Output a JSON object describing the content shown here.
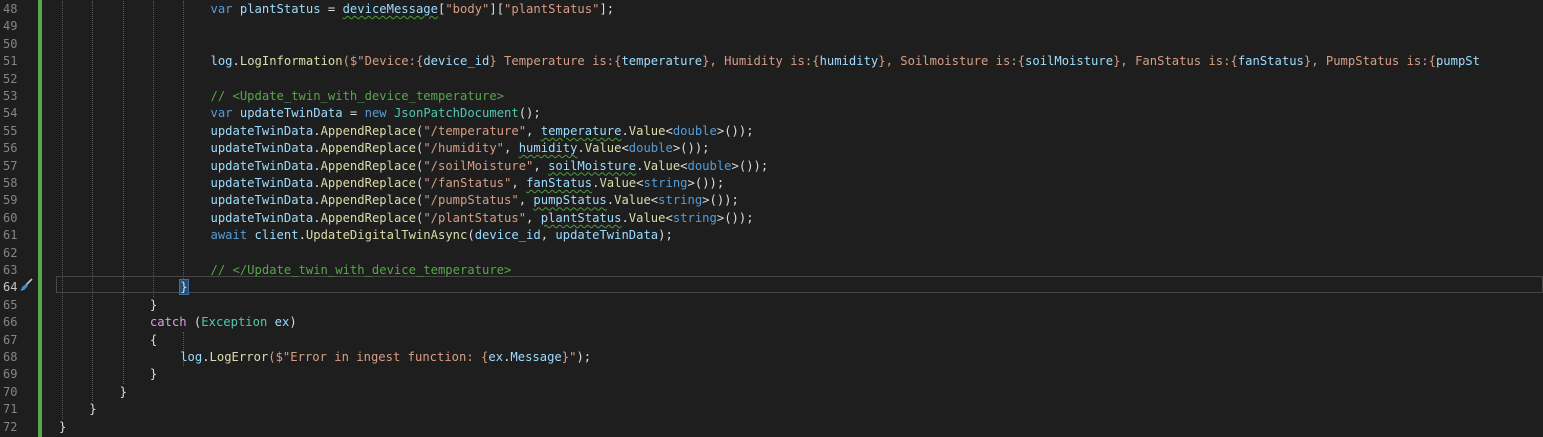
{
  "editor": {
    "line_numbers": [
      "48",
      "49",
      "50",
      "51",
      "52",
      "53",
      "54",
      "55",
      "56",
      "57",
      "58",
      "59",
      "60",
      "61",
      "62",
      "63",
      "64",
      "65",
      "66",
      "67",
      "68",
      "69",
      "70",
      "71",
      "72"
    ],
    "current_line": "64",
    "lines": [
      {
        "indent": 5,
        "tokens": [
          {
            "t": "var ",
            "c": "kw"
          },
          {
            "t": "plantStatus",
            "c": "var"
          },
          {
            "t": " = ",
            "c": "plain"
          },
          {
            "t": "deviceMessage",
            "c": "var",
            "sq": true
          },
          {
            "t": "[",
            "c": "plain"
          },
          {
            "t": "\"body\"",
            "c": "str"
          },
          {
            "t": "][",
            "c": "plain"
          },
          {
            "t": "\"plantStatus\"",
            "c": "str"
          },
          {
            "t": "];",
            "c": "plain"
          }
        ]
      },
      {
        "indent": 0,
        "tokens": []
      },
      {
        "indent": 0,
        "tokens": []
      },
      {
        "indent": 5,
        "tokens": [
          {
            "t": "log",
            "c": "var"
          },
          {
            "t": ".",
            "c": "plain"
          },
          {
            "t": "LogInformation",
            "c": "method"
          },
          {
            "t": "($\"Device:{",
            "c": "str"
          },
          {
            "t": "device_id",
            "c": "interp"
          },
          {
            "t": "} Temperature is:{",
            "c": "str"
          },
          {
            "t": "temperature",
            "c": "interp"
          },
          {
            "t": "}, Humidity is:{",
            "c": "str"
          },
          {
            "t": "humidity",
            "c": "interp"
          },
          {
            "t": "}, Soilmoisture is:{",
            "c": "str"
          },
          {
            "t": "soilMoisture",
            "c": "interp"
          },
          {
            "t": "}, FanStatus is:{",
            "c": "str"
          },
          {
            "t": "fanStatus",
            "c": "interp"
          },
          {
            "t": "}, PumpStatus is:{",
            "c": "str"
          },
          {
            "t": "pumpSt",
            "c": "interp"
          }
        ]
      },
      {
        "indent": 0,
        "tokens": []
      },
      {
        "indent": 5,
        "tokens": [
          {
            "t": "// <Update_twin_with_device_temperature>",
            "c": "cmt"
          }
        ]
      },
      {
        "indent": 5,
        "tokens": [
          {
            "t": "var ",
            "c": "kw"
          },
          {
            "t": "updateTwinData",
            "c": "var"
          },
          {
            "t": " = ",
            "c": "plain"
          },
          {
            "t": "new ",
            "c": "kw"
          },
          {
            "t": "JsonPatchDocument",
            "c": "type"
          },
          {
            "t": "();",
            "c": "plain"
          }
        ]
      },
      {
        "indent": 5,
        "tokens": [
          {
            "t": "updateTwinData",
            "c": "var"
          },
          {
            "t": ".",
            "c": "plain"
          },
          {
            "t": "AppendReplace",
            "c": "method"
          },
          {
            "t": "(",
            "c": "plain"
          },
          {
            "t": "\"/temperature\"",
            "c": "str"
          },
          {
            "t": ", ",
            "c": "plain"
          },
          {
            "t": "temperature",
            "c": "var",
            "sq": true
          },
          {
            "t": ".",
            "c": "plain"
          },
          {
            "t": "Value",
            "c": "method"
          },
          {
            "t": "<",
            "c": "plain"
          },
          {
            "t": "double",
            "c": "kw"
          },
          {
            "t": ">());",
            "c": "plain"
          }
        ]
      },
      {
        "indent": 5,
        "tokens": [
          {
            "t": "updateTwinData",
            "c": "var"
          },
          {
            "t": ".",
            "c": "plain"
          },
          {
            "t": "AppendReplace",
            "c": "method"
          },
          {
            "t": "(",
            "c": "plain"
          },
          {
            "t": "\"/humidity\"",
            "c": "str"
          },
          {
            "t": ", ",
            "c": "plain"
          },
          {
            "t": "humidity",
            "c": "var",
            "sq": true
          },
          {
            "t": ".",
            "c": "plain"
          },
          {
            "t": "Value",
            "c": "method"
          },
          {
            "t": "<",
            "c": "plain"
          },
          {
            "t": "double",
            "c": "kw"
          },
          {
            "t": ">());",
            "c": "plain"
          }
        ]
      },
      {
        "indent": 5,
        "tokens": [
          {
            "t": "updateTwinData",
            "c": "var"
          },
          {
            "t": ".",
            "c": "plain"
          },
          {
            "t": "AppendReplace",
            "c": "method"
          },
          {
            "t": "(",
            "c": "plain"
          },
          {
            "t": "\"/soilMoisture\"",
            "c": "str"
          },
          {
            "t": ", ",
            "c": "plain"
          },
          {
            "t": "soilMoisture",
            "c": "var",
            "sq": true
          },
          {
            "t": ".",
            "c": "plain"
          },
          {
            "t": "Value",
            "c": "method"
          },
          {
            "t": "<",
            "c": "plain"
          },
          {
            "t": "double",
            "c": "kw"
          },
          {
            "t": ">());",
            "c": "plain"
          }
        ]
      },
      {
        "indent": 5,
        "tokens": [
          {
            "t": "updateTwinData",
            "c": "var"
          },
          {
            "t": ".",
            "c": "plain"
          },
          {
            "t": "AppendReplace",
            "c": "method"
          },
          {
            "t": "(",
            "c": "plain"
          },
          {
            "t": "\"/fanStatus\"",
            "c": "str"
          },
          {
            "t": ", ",
            "c": "plain"
          },
          {
            "t": "fanStatus",
            "c": "var",
            "sq": true
          },
          {
            "t": ".",
            "c": "plain"
          },
          {
            "t": "Value",
            "c": "method"
          },
          {
            "t": "<",
            "c": "plain"
          },
          {
            "t": "string",
            "c": "kw"
          },
          {
            "t": ">());",
            "c": "plain"
          }
        ]
      },
      {
        "indent": 5,
        "tokens": [
          {
            "t": "updateTwinData",
            "c": "var"
          },
          {
            "t": ".",
            "c": "plain"
          },
          {
            "t": "AppendReplace",
            "c": "method"
          },
          {
            "t": "(",
            "c": "plain"
          },
          {
            "t": "\"/pumpStatus\"",
            "c": "str"
          },
          {
            "t": ", ",
            "c": "plain"
          },
          {
            "t": "pumpStatus",
            "c": "var",
            "sq": true
          },
          {
            "t": ".",
            "c": "plain"
          },
          {
            "t": "Value",
            "c": "method"
          },
          {
            "t": "<",
            "c": "plain"
          },
          {
            "t": "string",
            "c": "kw"
          },
          {
            "t": ">());",
            "c": "plain"
          }
        ]
      },
      {
        "indent": 5,
        "tokens": [
          {
            "t": "updateTwinData",
            "c": "var"
          },
          {
            "t": ".",
            "c": "plain"
          },
          {
            "t": "AppendReplace",
            "c": "method"
          },
          {
            "t": "(",
            "c": "plain"
          },
          {
            "t": "\"/plantStatus\"",
            "c": "str"
          },
          {
            "t": ", ",
            "c": "plain"
          },
          {
            "t": "plantStatus",
            "c": "var",
            "sq": true
          },
          {
            "t": ".",
            "c": "plain"
          },
          {
            "t": "Value",
            "c": "method"
          },
          {
            "t": "<",
            "c": "plain"
          },
          {
            "t": "string",
            "c": "kw"
          },
          {
            "t": ">());",
            "c": "plain"
          }
        ]
      },
      {
        "indent": 5,
        "tokens": [
          {
            "t": "await ",
            "c": "kw"
          },
          {
            "t": "client",
            "c": "var"
          },
          {
            "t": ".",
            "c": "plain"
          },
          {
            "t": "UpdateDigitalTwinAsync",
            "c": "method"
          },
          {
            "t": "(",
            "c": "plain"
          },
          {
            "t": "device_id",
            "c": "var"
          },
          {
            "t": ", ",
            "c": "plain"
          },
          {
            "t": "updateTwinData",
            "c": "var"
          },
          {
            "t": ");",
            "c": "plain"
          }
        ]
      },
      {
        "indent": 0,
        "tokens": []
      },
      {
        "indent": 5,
        "tokens": [
          {
            "t": "// </Update_twin_with_device_temperature>",
            "c": "cmt"
          }
        ]
      },
      {
        "indent": 4,
        "tokens": [
          {
            "t": "}",
            "c": "plain",
            "hl": true,
            "caret": true
          }
        ]
      },
      {
        "indent": 3,
        "tokens": [
          {
            "t": "}",
            "c": "plain"
          }
        ]
      },
      {
        "indent": 3,
        "tokens": [
          {
            "t": "catch ",
            "c": "ctl"
          },
          {
            "t": "(",
            "c": "plain"
          },
          {
            "t": "Exception ",
            "c": "type"
          },
          {
            "t": "ex",
            "c": "var"
          },
          {
            "t": ")",
            "c": "plain"
          }
        ]
      },
      {
        "indent": 3,
        "tokens": [
          {
            "t": "{",
            "c": "plain"
          }
        ]
      },
      {
        "indent": 4,
        "tokens": [
          {
            "t": "log",
            "c": "var"
          },
          {
            "t": ".",
            "c": "plain"
          },
          {
            "t": "LogError",
            "c": "method"
          },
          {
            "t": "($\"Error in ingest function: {",
            "c": "str"
          },
          {
            "t": "ex",
            "c": "interp"
          },
          {
            "t": ".",
            "c": "plain"
          },
          {
            "t": "Message",
            "c": "interp"
          },
          {
            "t": "}\"",
            "c": "str"
          },
          {
            "t": ");",
            "c": "plain"
          }
        ]
      },
      {
        "indent": 3,
        "tokens": [
          {
            "t": "}",
            "c": "plain"
          }
        ]
      },
      {
        "indent": 2,
        "tokens": [
          {
            "t": "}",
            "c": "plain"
          }
        ]
      },
      {
        "indent": 1,
        "tokens": [
          {
            "t": "}",
            "c": "plain"
          }
        ]
      },
      {
        "indent": 0,
        "tokens": [
          {
            "t": "}",
            "c": "plain"
          }
        ]
      }
    ]
  }
}
